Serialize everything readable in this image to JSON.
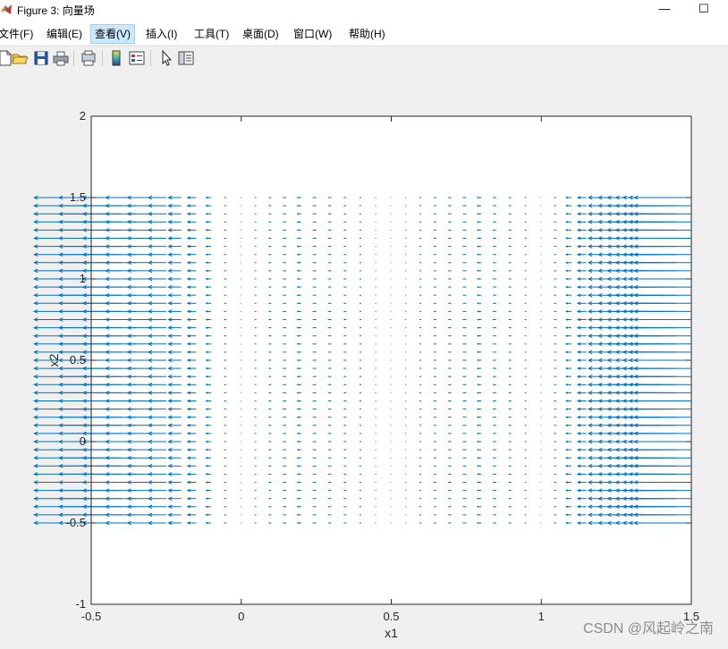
{
  "window": {
    "title": "Figure 3: 向量场",
    "minimize_glyph": "—",
    "maximize_glyph": "☐"
  },
  "menu": {
    "items": [
      "文件(F)",
      "编辑(E)",
      "查看(V)",
      "插入(I)",
      "工具(T)",
      "桌面(D)",
      "窗口(W)",
      "帮助(H)"
    ],
    "active": "查看(V)"
  },
  "toolbar": {
    "icons": [
      "new-figure-icon",
      "open-file-icon",
      "save-icon",
      "print-icon",
      "print-preview-icon",
      "colorbar-icon",
      "legend-icon",
      "edit-plot-arrow-icon",
      "property-inspector-icon"
    ]
  },
  "colors": {
    "quiver": "#0072bd",
    "axes": "#262626",
    "plot_background": "#ffffff",
    "figure_background": "#f0f0f0"
  },
  "chart_data": {
    "type": "quiver",
    "xlabel": "x1",
    "ylabel": "x2",
    "xlim": [
      -0.5,
      1.5
    ],
    "ylim": [
      -1,
      2
    ],
    "x_ticks": [
      -0.5,
      0,
      0.5,
      1,
      1.5
    ],
    "x_tick_labels": [
      "-0.5",
      "0",
      "0.5",
      "1",
      "1.5"
    ],
    "y_ticks": [
      -1,
      -0.5,
      0,
      0.5,
      1,
      1.5,
      2
    ],
    "y_tick_labels": [
      "-1",
      "-0.5",
      "0",
      "0.5",
      "1",
      "1.5",
      "2"
    ],
    "grid": false,
    "box": true,
    "grid_x_range": [
      -0.5,
      1.5
    ],
    "grid_y_range": [
      -0.5,
      1.5
    ],
    "grid_step": 0.05,
    "vector_field": "dx1 = -x1*(x1-0.5)*(x1-1), dx2 = 0 (visual approximation: vectors point in -x direction, zero at x1 = 0, 0.5, 1)"
  },
  "watermark": "CSDN @风起岭之南"
}
